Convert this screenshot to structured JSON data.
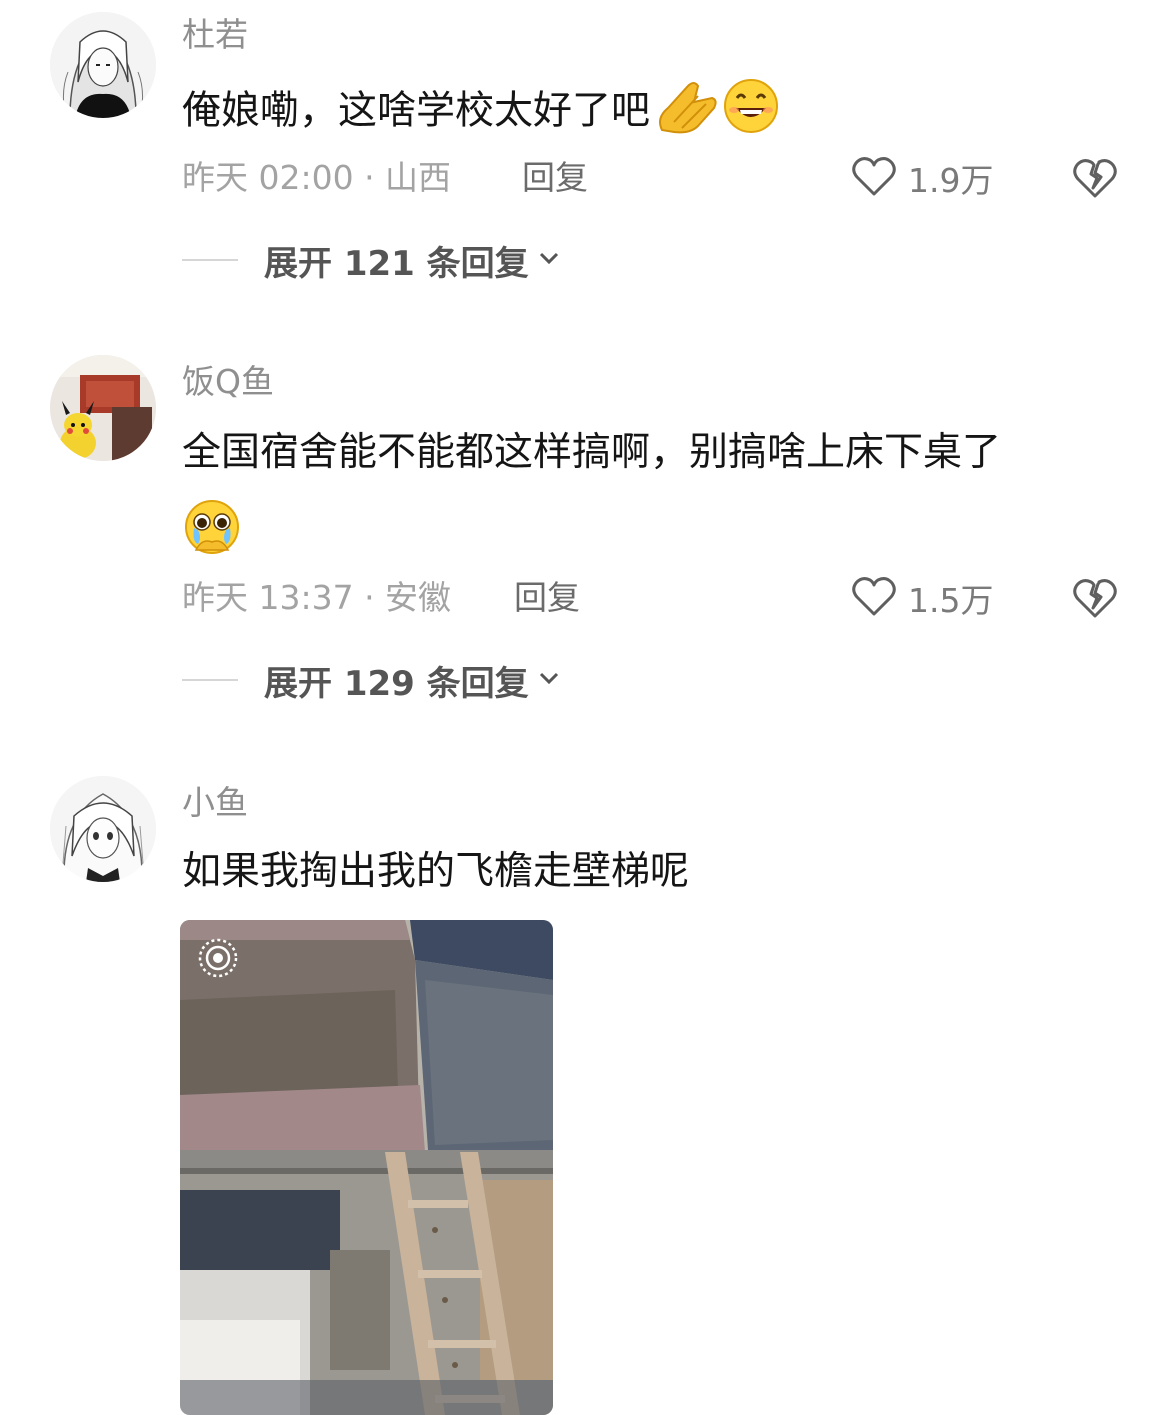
{
  "comments": [
    {
      "username": "杜若",
      "text": "俺娘嘞，这啥学校太好了吧",
      "emojis": [
        "folded-hands-emoji",
        "smiling-face-emoji"
      ],
      "time": "昨天 02:00 · 山西",
      "reply_label": "回复",
      "likes": "1.9万",
      "expand_label": "展开 121 条回复"
    },
    {
      "username": "饭Q鱼",
      "text": "全国宿舍能不能都这样搞啊，别搞啥上床下桌了",
      "emojis": [
        "pleading-face-emoji"
      ],
      "time": "昨天 13:37 · 安徽",
      "reply_label": "回复",
      "likes": "1.5万",
      "expand_label": "展开 129 条回复"
    },
    {
      "username": "小鱼",
      "text": "如果我掏出我的飞檐走壁梯呢",
      "image": "dorm-bunk-photo"
    }
  ],
  "icons": {
    "like": "heart-outline-icon",
    "dislike": "broken-heart-icon",
    "expand": "chevron-down-icon",
    "live": "live-photo-icon"
  },
  "colors": {
    "text": "#151515",
    "meta": "#a3a3a3",
    "username": "#8f8f8f"
  }
}
